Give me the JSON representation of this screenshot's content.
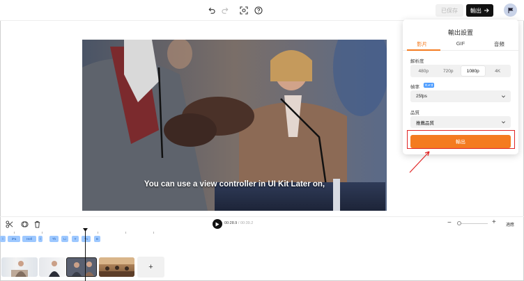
{
  "topbar": {
    "saved_label": "已保存",
    "export_label": "輸出",
    "icons": [
      "undo-icon",
      "redo-icon",
      "screenshot-icon",
      "help-icon"
    ]
  },
  "video": {
    "subtitle": "You can use a view controller in UI Kit Later on,"
  },
  "export_panel": {
    "title": "輸出設置",
    "tabs": [
      {
        "label": "影片",
        "active": true
      },
      {
        "label": "GIF",
        "active": false
      },
      {
        "label": "音頻",
        "active": false
      }
    ],
    "resolution_label": "解析度",
    "resolutions": [
      {
        "label": "480p",
        "selected": false
      },
      {
        "label": "720p",
        "selected": false
      },
      {
        "label": "1080p",
        "selected": true
      },
      {
        "label": "4K",
        "selected": false
      }
    ],
    "framerate_label": "幀率",
    "framerate_badge": "測試版",
    "framerate_value": "25fps",
    "quality_label": "品質",
    "quality_value": "推薦品質",
    "export_button": "輸出",
    "accent_color": "#f47b20"
  },
  "timeline": {
    "current_time": "00:28.9",
    "total_time": "/ 00:39.2",
    "fit_label": "適應",
    "subtitle_chips": [
      "l",
      "iPa",
      "Hell",
      "l",
      "Th",
      "Li",
      "Y",
      "Yo",
      "B"
    ]
  }
}
